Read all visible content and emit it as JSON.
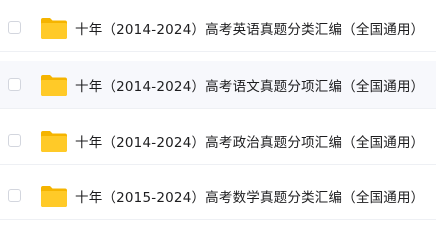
{
  "files": [
    {
      "name": "十年（2014-2024）高考英语真题分类汇编（全国通用）",
      "icon": "folder-icon"
    },
    {
      "name": "十年（2014-2024）高考语文真题分项汇编（全国通用）",
      "icon": "folder-icon"
    },
    {
      "name": "十年（2014-2024）高考政治真题分项汇编（全国通用）",
      "icon": "folder-icon"
    },
    {
      "name": "十年（2015-2024）高考数学真题分类汇编（全国通用）",
      "icon": "folder-icon"
    }
  ],
  "colors": {
    "folder_back": "#F5B400",
    "folder_front": "#FFCA28",
    "row_alt_background": "#F7F8FC"
  }
}
